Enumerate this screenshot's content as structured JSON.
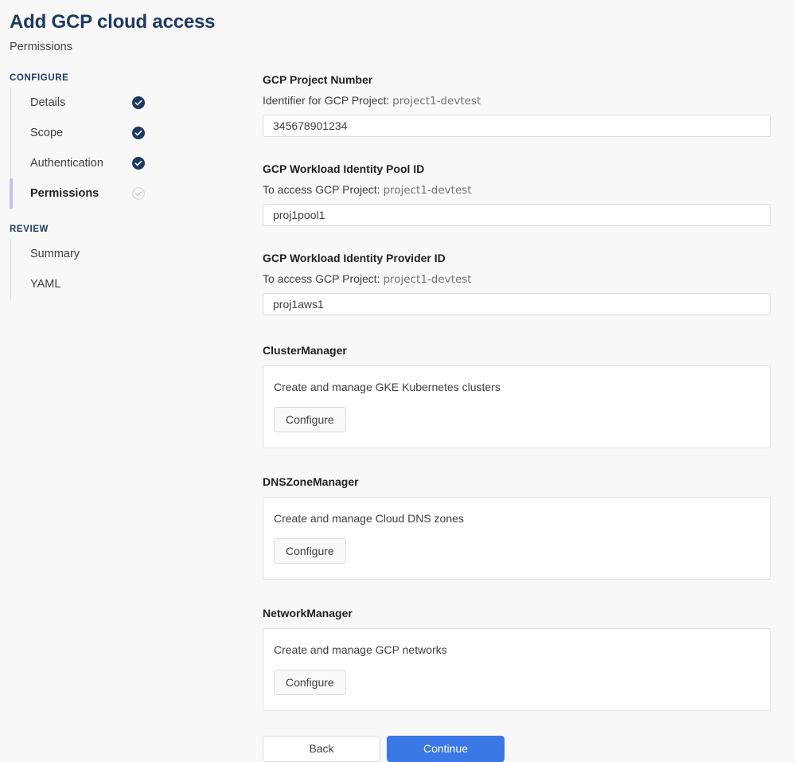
{
  "header": {
    "title": "Add GCP cloud access",
    "subtitle": "Permissions"
  },
  "sidebar": {
    "sections": [
      {
        "title": "CONFIGURE",
        "items": [
          {
            "label": "Details",
            "status": "check-filled"
          },
          {
            "label": "Scope",
            "status": "check-filled"
          },
          {
            "label": "Authentication",
            "status": "check-filled"
          },
          {
            "label": "Permissions",
            "status": "check-outline",
            "active": true
          }
        ]
      },
      {
        "title": "REVIEW",
        "items": [
          {
            "label": "Summary",
            "status": "none"
          },
          {
            "label": "YAML",
            "status": "none"
          }
        ]
      }
    ]
  },
  "fields": [
    {
      "label": "GCP Project Number",
      "help_prefix": "Identifier for GCP Project:",
      "project_name": "project1-devtest",
      "value": "345678901234"
    },
    {
      "label": "GCP Workload Identity Pool ID",
      "help_prefix": "To access GCP Project:",
      "project_name": "project1-devtest",
      "value": "proj1pool1"
    },
    {
      "label": "GCP Workload Identity Provider ID",
      "help_prefix": "To access GCP Project:",
      "project_name": "project1-devtest",
      "value": "proj1aws1"
    }
  ],
  "permissions": [
    {
      "title": "ClusterManager",
      "description": "Create and manage GKE Kubernetes clusters",
      "button": "Configure"
    },
    {
      "title": "DNSZoneManager",
      "description": "Create and manage Cloud DNS zones",
      "button": "Configure"
    },
    {
      "title": "NetworkManager",
      "description": "Create and manage GCP networks",
      "button": "Configure"
    }
  ],
  "actions": {
    "back": "Back",
    "continue": "Continue"
  },
  "colors": {
    "title": "#1f3864",
    "accent_primary": "#3b78e7",
    "active_rail": "#c6c3f0",
    "check_filled": "#1f3864",
    "page_background": "#f8f8f8"
  }
}
